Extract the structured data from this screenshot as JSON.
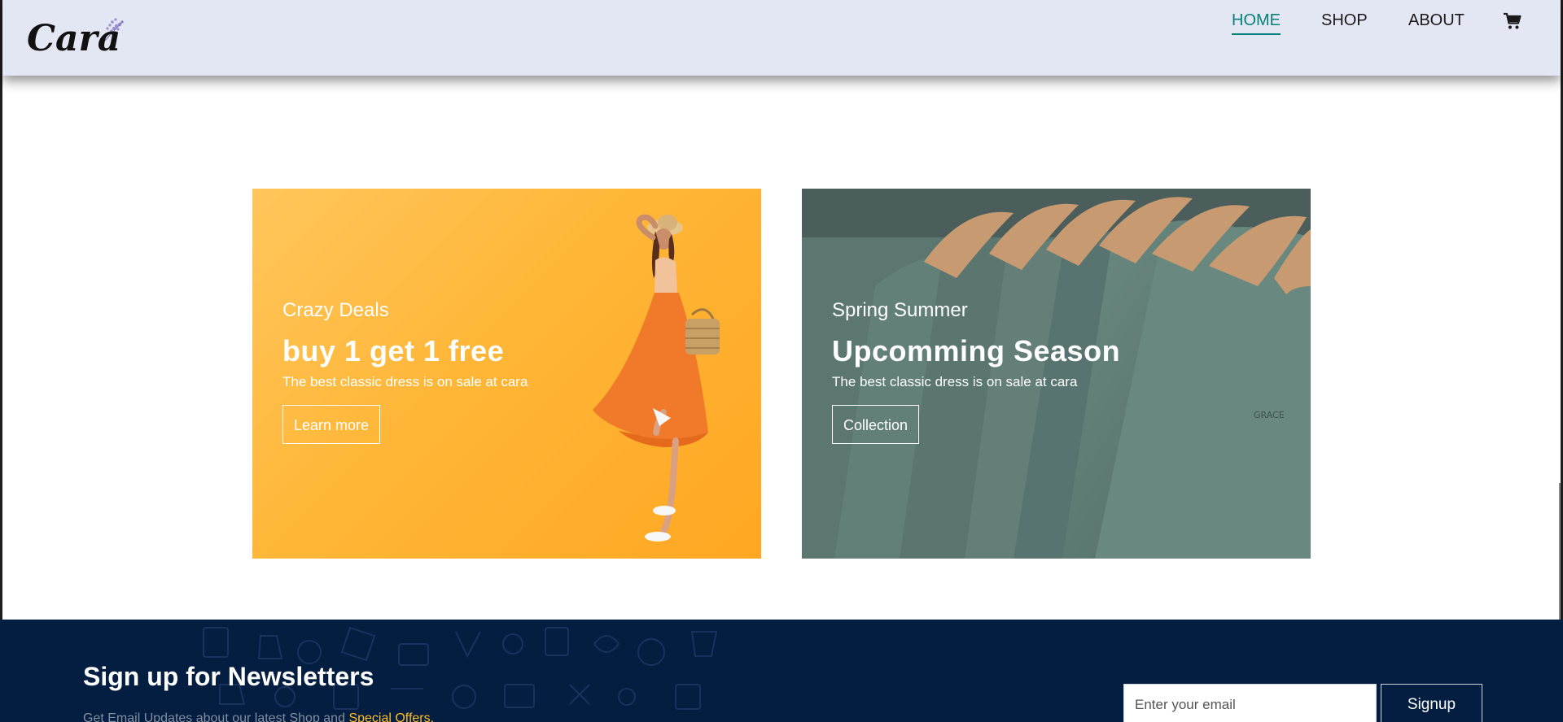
{
  "header": {
    "logo_text": "Cara",
    "nav": [
      {
        "label": "HOME",
        "active": true
      },
      {
        "label": "SHOP",
        "active": false
      },
      {
        "label": "ABOUT",
        "active": false
      }
    ],
    "cart_icon": "shopping-cart-icon",
    "accent_color": "#088178"
  },
  "banners": [
    {
      "kicker": "Crazy Deals",
      "title": "buy 1 get 1 free",
      "text": "The best classic dress is on sale at cara",
      "button": "Learn more",
      "background": "#ffb637"
    },
    {
      "kicker": "Spring Summer",
      "title": "Upcomming Season",
      "text": "The best classic dress is on sale at cara",
      "button": "Collection",
      "background": "#5f7a73"
    }
  ],
  "newsletter": {
    "title": "Sign up for Newsletters",
    "subtitle_prefix": "Get Email Updates about our latest Shop and",
    "subtitle_highlight": "Special Offers.",
    "email_placeholder": "Enter your email",
    "signup_label": "Signup",
    "background": "#041e42",
    "highlight_color": "#ffbd27"
  }
}
